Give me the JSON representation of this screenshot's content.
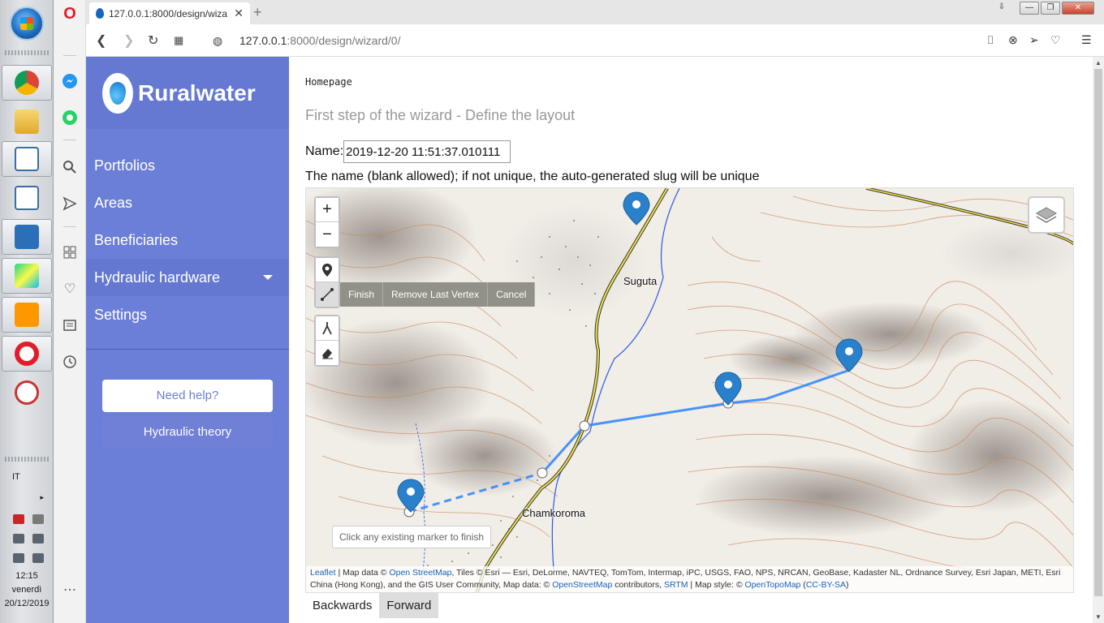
{
  "browser": {
    "tab_title": "127.0.0.1:8000/design/wiza",
    "url_host": "127.0.0.1",
    "url_rest": ":8000/design/wizard/0/"
  },
  "taskbar": {
    "lang": "IT",
    "time": "12:15",
    "day": "venerdì",
    "date": "20/12/2019"
  },
  "sidebar": {
    "brand": "Ruralwater",
    "items": [
      {
        "label": "Portfolios"
      },
      {
        "label": "Areas"
      },
      {
        "label": "Beneficiaries"
      },
      {
        "label": "Hydraulic hardware"
      },
      {
        "label": "Settings"
      }
    ],
    "help_label": "Need help?",
    "theory_label": "Hydraulic theory"
  },
  "main": {
    "breadcrumb": "Homepage",
    "title": "First step of the wizard - Define the layout",
    "name_label": "Name:",
    "name_value": "2019-12-20 11:51:37.010111",
    "hint": "The name (blank allowed); if not unique, the auto-generated slug will be unique"
  },
  "map": {
    "zoom_in": "+",
    "zoom_out": "−",
    "finish": "Finish",
    "remove_last": "Remove Last Vertex",
    "cancel": "Cancel",
    "tooltip": "Click any existing marker to finish",
    "places": {
      "suguta": "Suguta",
      "chamkoroma": "Chamkoroma"
    },
    "attribution": {
      "leaflet": "Leaflet",
      "t1": " | Map data © ",
      "osm1": "Open StreetMap",
      "t2": ", Tiles © Esri — Esri, DeLorme, NAVTEQ, TomTom, Intermap, iPC, USGS, FAO, NPS, NRCAN, GeoBase, Kadaster NL, Ordnance Survey, Esri Japan, METI, Esri China (Hong Kong), and the GIS User Community, Map data: © ",
      "osm2": "OpenStreetMap",
      "t3": " contributors, ",
      "srtm": "SRTM",
      "t4": " | Map style: © ",
      "otm": "OpenTopoMap",
      "t5": " (",
      "ccbysa": "CC-BY-SA",
      "t6": ")"
    },
    "colors": {
      "route": "#3388ff",
      "marker": "#2a81cb",
      "road": "#f2e34c",
      "river": "#2a5adf",
      "contour": "#c9875a"
    }
  },
  "footer": {
    "backwards": "Backwards",
    "forward": "Forward"
  }
}
